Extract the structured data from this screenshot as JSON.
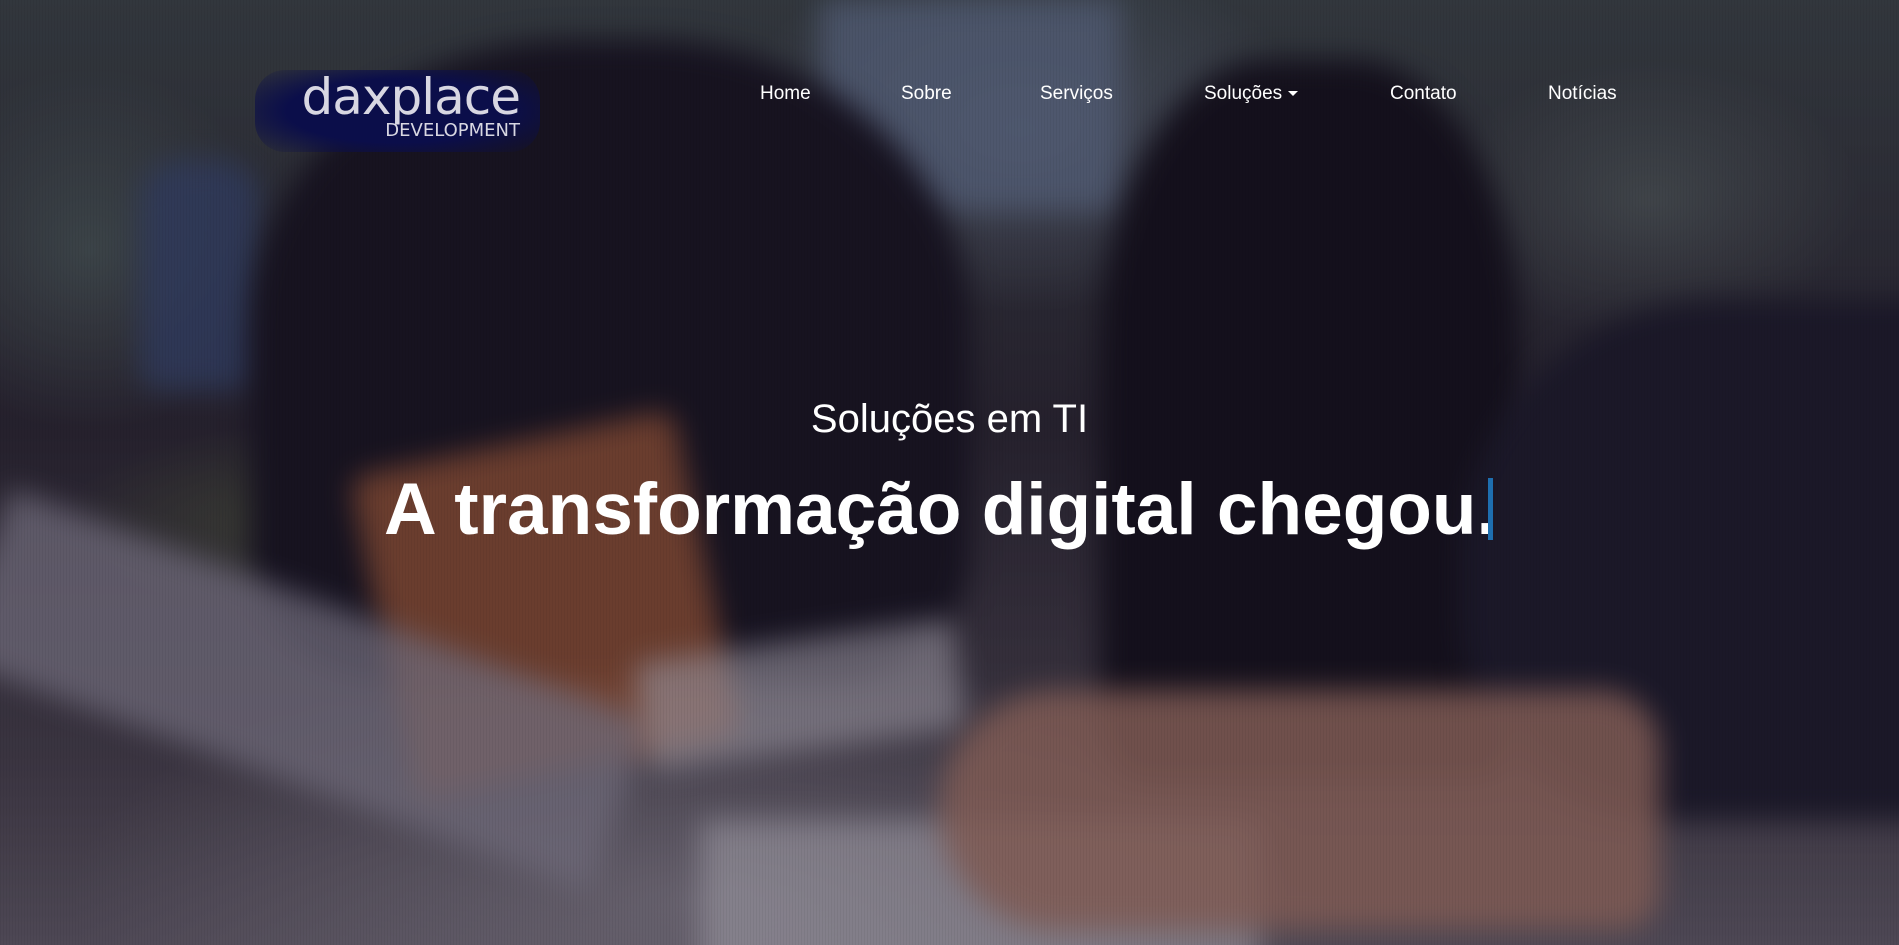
{
  "logo": {
    "main": "daxplace",
    "sub": "DEVELOPMENT"
  },
  "nav": {
    "items": [
      {
        "label": "Home"
      },
      {
        "label": "Sobre"
      },
      {
        "label": "Serviços"
      },
      {
        "label": "Soluções",
        "has_dropdown": true
      },
      {
        "label": "Contato"
      },
      {
        "label": "Notícias"
      }
    ]
  },
  "hero": {
    "subtitle": "Soluções em TI",
    "headline": "A transformação digital chegou.",
    "background": "blurred office photo of hands typing on a keyboard",
    "cursor_color": "#1e6fb0"
  },
  "colors": {
    "text": "#ffffff",
    "logo_bg": "#0b0e4a",
    "accent": "#1e6fb0"
  }
}
